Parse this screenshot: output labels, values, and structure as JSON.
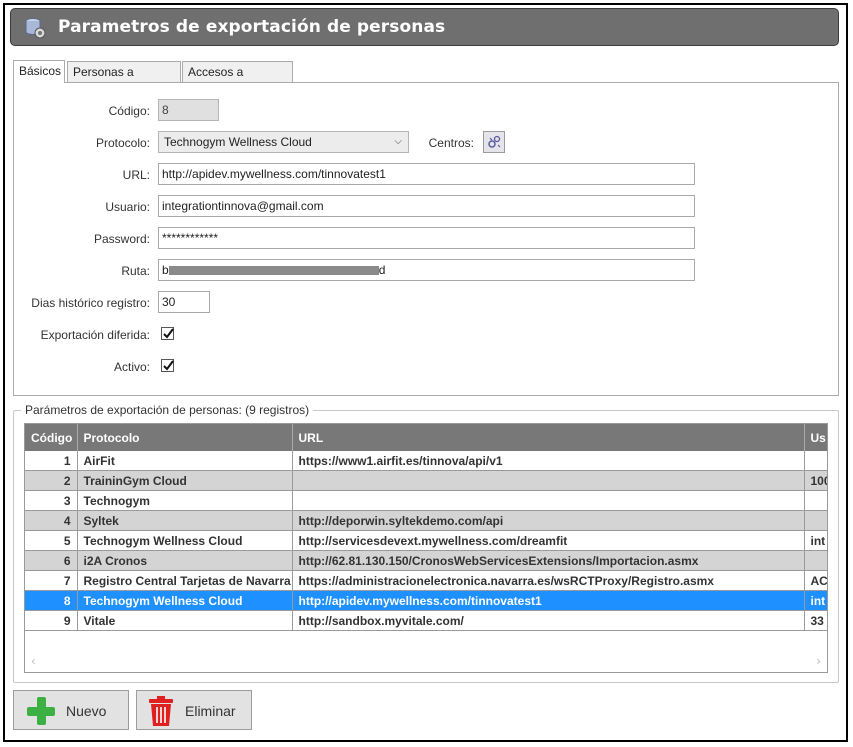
{
  "window": {
    "title": "Parametros de exportación de personas"
  },
  "tabs": [
    {
      "label": "Básicos",
      "active": true
    },
    {
      "label": "Personas a exportar",
      "active": false
    },
    {
      "label": "Accesos a exportar",
      "active": false
    }
  ],
  "form": {
    "codigo": {
      "label": "Código:",
      "value": "8"
    },
    "protocolo": {
      "label": "Protocolo:",
      "value": "Technogym Wellness Cloud"
    },
    "centros": {
      "label": "Centros:",
      "icon": "settings-icon"
    },
    "url": {
      "label": "URL:",
      "value": "http://apidev.mywellness.com/tinnovatest1"
    },
    "usuario": {
      "label": "Usuario:",
      "value": "integrationtinnova@gmail.com"
    },
    "password": {
      "label": "Password:",
      "value": "************"
    },
    "ruta": {
      "label": "Ruta:",
      "value_start": "b",
      "value_end": "d"
    },
    "dias": {
      "label": "Dias histórico registro:",
      "value": "30"
    },
    "diferida": {
      "label": "Exportación diferida:",
      "checked": true
    },
    "activo": {
      "label": "Activo:",
      "checked": true
    }
  },
  "group": {
    "title": "Parámetros de exportación de personas:  (9 registros)"
  },
  "grid": {
    "columns": [
      "Código",
      "Protocolo",
      "URL",
      "Us"
    ],
    "rows": [
      {
        "codigo": "1",
        "protocolo": "AirFit",
        "url": "https://www1.airfit.es/tinnova/api/v1",
        "usuario": ""
      },
      {
        "codigo": "2",
        "protocolo": "TraininGym Cloud",
        "url": "",
        "usuario": "100"
      },
      {
        "codigo": "3",
        "protocolo": "Technogym",
        "url": "",
        "usuario": ""
      },
      {
        "codigo": "4",
        "protocolo": "Syltek",
        "url": "http://deporwin.syltekdemo.com/api",
        "usuario": ""
      },
      {
        "codigo": "5",
        "protocolo": "Technogym Wellness Cloud",
        "url": "http://servicesdevext.mywellness.com/dreamfit",
        "usuario": "int"
      },
      {
        "codigo": "6",
        "protocolo": "i2A Cronos",
        "url": "http://62.81.130.150/CronosWebServicesExtensions/Importacion.asmx",
        "usuario": ""
      },
      {
        "codigo": "7",
        "protocolo": "Registro Central Tarjetas de Navarra",
        "url": "https://administracionelectronica.navarra.es/wsRCTProxy/Registro.asmx",
        "usuario": "AC"
      },
      {
        "codigo": "8",
        "protocolo": "Technogym Wellness Cloud",
        "url": "http://apidev.mywellness.com/tinnovatest1",
        "usuario": "int"
      },
      {
        "codigo": "9",
        "protocolo": "Vitale",
        "url": "http://sandbox.myvitale.com/",
        "usuario": "33"
      }
    ],
    "selected_index": 7
  },
  "buttons": {
    "nuevo": "Nuevo",
    "eliminar": "Eliminar"
  },
  "colors": {
    "titlebar": "#6f6f6f",
    "header": "#787878",
    "row_alt": "#d4d4d4",
    "selection": "#1e90ff",
    "add_green": "#3cb043",
    "delete_red": "#e02020"
  }
}
